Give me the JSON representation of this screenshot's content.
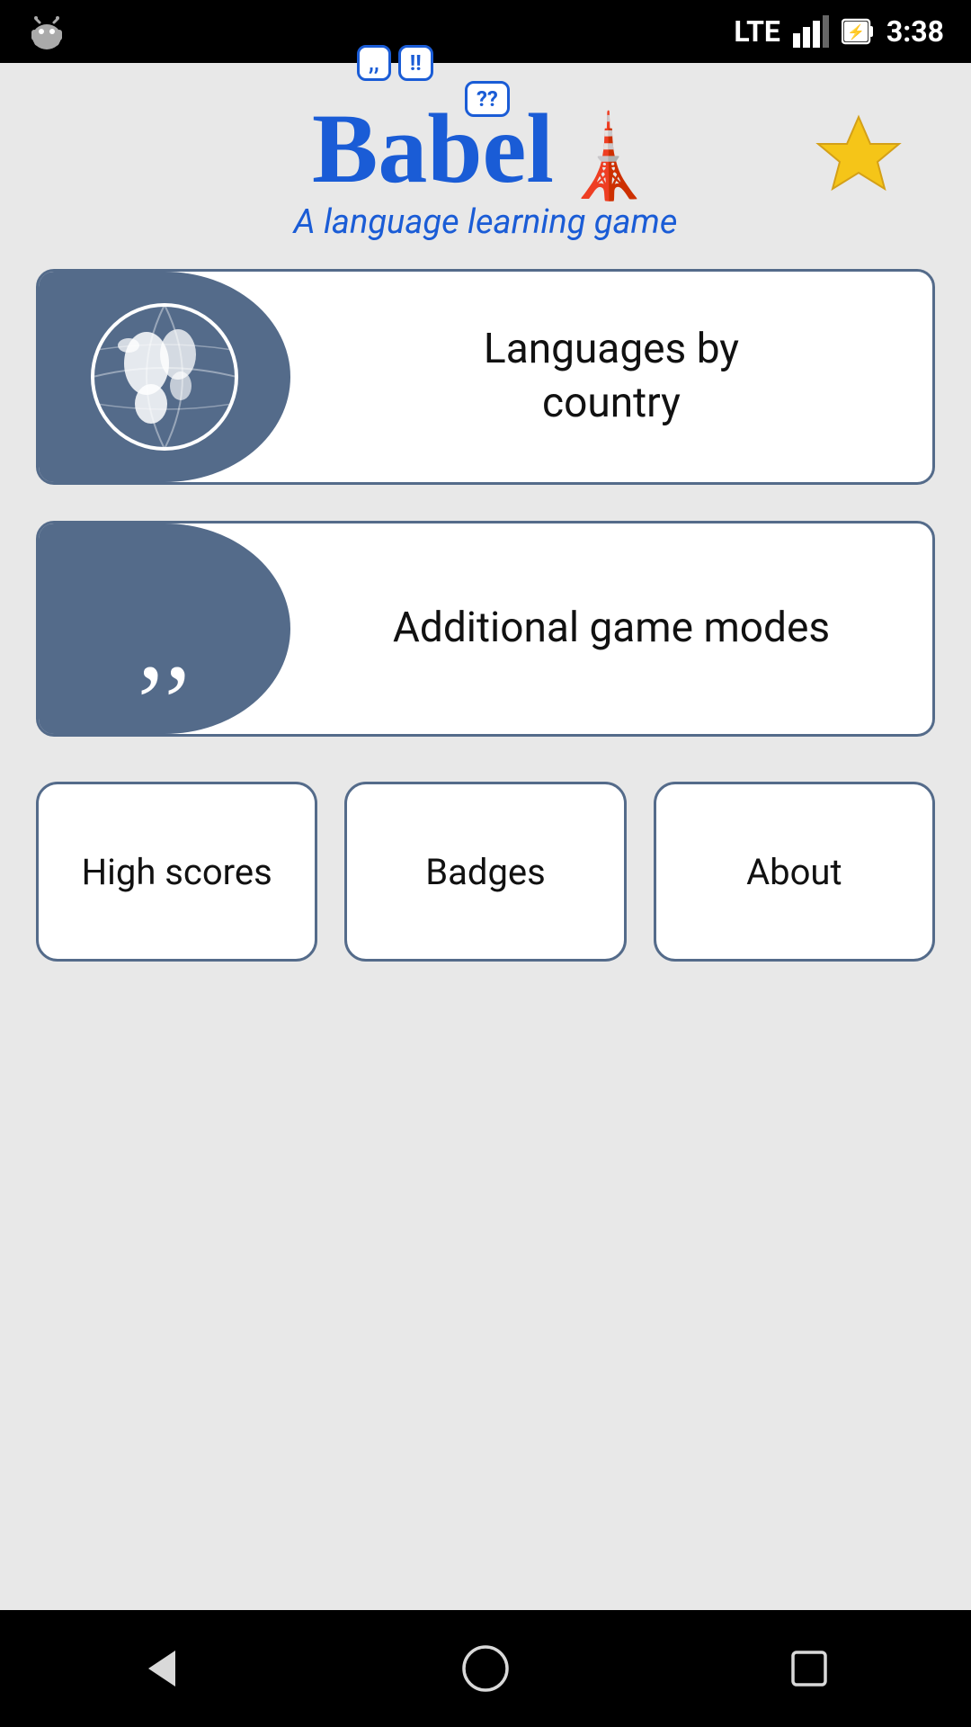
{
  "statusBar": {
    "time": "3:38",
    "lte": "LTE"
  },
  "header": {
    "appName": "Babel",
    "subtitle": "A language learning game",
    "starLabel": "favorites-star"
  },
  "gameButtons": [
    {
      "id": "languages-by-country",
      "label": "Languages by\ncountry",
      "icon": "globe-icon"
    },
    {
      "id": "additional-game-modes",
      "label": "Additional game modes",
      "icon": "quotes-icon"
    }
  ],
  "bottomButtons": [
    {
      "id": "high-scores",
      "label": "High scores"
    },
    {
      "id": "badges",
      "label": "Badges"
    },
    {
      "id": "about",
      "label": "About"
    }
  ],
  "navBar": {
    "back": "back-nav",
    "home": "home-nav",
    "recents": "recents-nav"
  }
}
